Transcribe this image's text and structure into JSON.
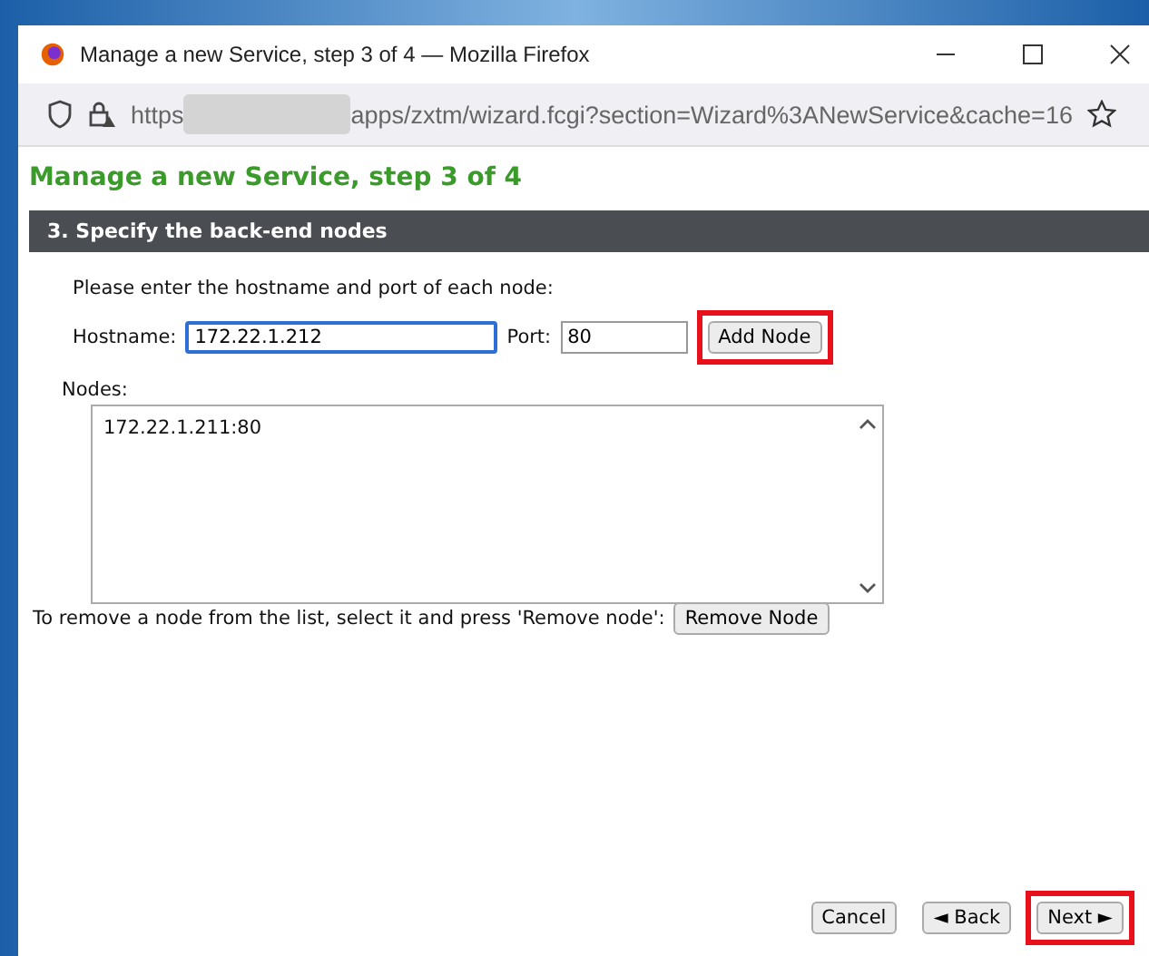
{
  "window": {
    "title": "Manage a new Service, step 3 of 4 — Mozilla Firefox"
  },
  "address_bar": {
    "scheme": "https",
    "path": "apps/zxtm/wizard.fcgi?section=Wizard%3ANewService&cache=16"
  },
  "page": {
    "heading": "Manage a new Service, step 3 of 4",
    "section_title": "3. Specify the back-end nodes",
    "instruction": "Please enter the hostname and port of each node:",
    "hostname": {
      "label": "Hostname:",
      "value": "172.22.1.212",
      "focused": true
    },
    "port": {
      "label": "Port:",
      "value": "80"
    },
    "add_button": {
      "label": "Add Node",
      "highlighted": true
    },
    "nodes_label": "Nodes:",
    "nodes": [
      {
        "text": "172.22.1.211:80",
        "selected": false
      }
    ],
    "remove_hint": "To remove a node from the list, select it and press 'Remove node':",
    "remove_button": {
      "label": "Remove Node",
      "highlighted": false
    }
  },
  "footer_buttons": [
    {
      "label": "Cancel",
      "highlighted": false
    },
    {
      "label": "◄ Back",
      "highlighted": false
    },
    {
      "label": "Next ►",
      "highlighted": true
    }
  ]
}
